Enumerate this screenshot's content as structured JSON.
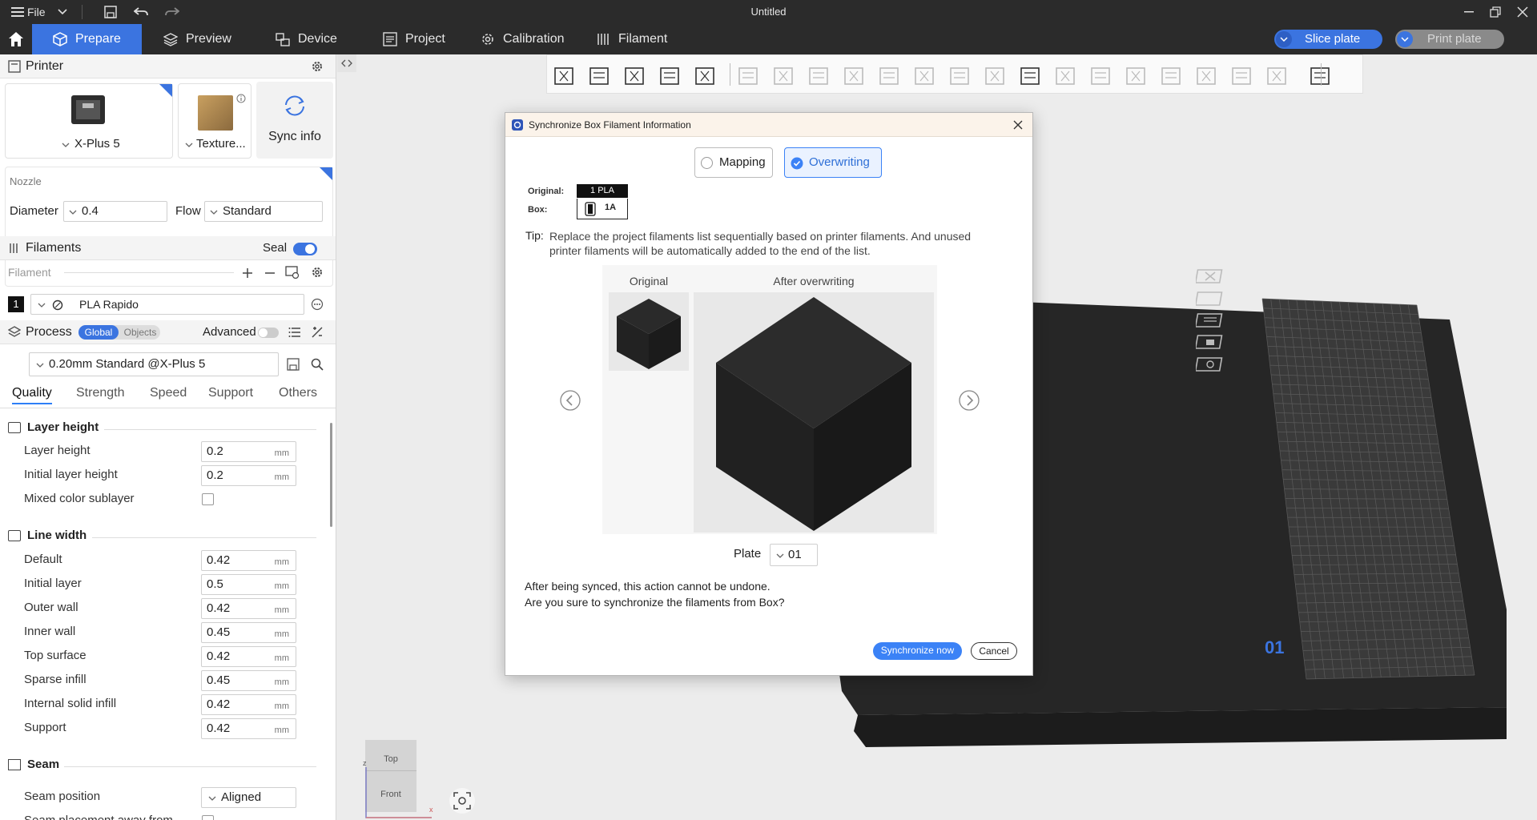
{
  "window": {
    "title": "Untitled",
    "menu_label": "File"
  },
  "tabs": [
    {
      "label": "Prepare",
      "icon": "cube-icon"
    },
    {
      "label": "Preview",
      "icon": "layers-icon"
    },
    {
      "label": "Device",
      "icon": "device-icon"
    },
    {
      "label": "Project",
      "icon": "project-icon"
    },
    {
      "label": "Calibration",
      "icon": "calibration-icon"
    },
    {
      "label": "Filament",
      "icon": "filament-icon"
    }
  ],
  "actions": {
    "slice": "Slice plate",
    "print": "Print plate"
  },
  "printer": {
    "section": "Printer",
    "name": "X-Plus 5",
    "plate": "Texture...",
    "sync": "Sync info",
    "nozzle_label": "Nozzle",
    "diameter_label": "Diameter",
    "diameter": "0.4",
    "flow_label": "Flow",
    "flow": "Standard"
  },
  "filaments": {
    "section": "Filaments",
    "seal_label": "Seal",
    "filament_label": "Filament",
    "items": [
      {
        "index": "1",
        "name": "PLA Rapido"
      }
    ]
  },
  "process": {
    "section": "Process",
    "global": "Global",
    "objects": "Objects",
    "advanced": "Advanced",
    "preset": "0.20mm Standard @X-Plus 5",
    "tabs": [
      "Quality",
      "Strength",
      "Speed",
      "Support",
      "Others"
    ],
    "groups": {
      "layer_height": {
        "title": "Layer height",
        "rows": [
          {
            "label": "Layer height",
            "value": "0.2",
            "unit": "mm"
          },
          {
            "label": "Initial layer height",
            "value": "0.2",
            "unit": "mm"
          }
        ],
        "mixed": "Mixed color sublayer"
      },
      "line_width": {
        "title": "Line width",
        "rows": [
          {
            "label": "Default",
            "value": "0.42",
            "unit": "mm"
          },
          {
            "label": "Initial layer",
            "value": "0.5",
            "unit": "mm"
          },
          {
            "label": "Outer wall",
            "value": "0.42",
            "unit": "mm"
          },
          {
            "label": "Inner wall",
            "value": "0.45",
            "unit": "mm"
          },
          {
            "label": "Top surface",
            "value": "0.42",
            "unit": "mm"
          },
          {
            "label": "Sparse infill",
            "value": "0.45",
            "unit": "mm"
          },
          {
            "label": "Internal solid infill",
            "value": "0.42",
            "unit": "mm"
          },
          {
            "label": "Support",
            "value": "0.42",
            "unit": "mm"
          }
        ]
      },
      "seam": {
        "title": "Seam",
        "position_label": "Seam position",
        "position": "Aligned",
        "away_label": "Seam placement away from"
      }
    }
  },
  "viewport": {
    "plate_number": "01",
    "view_cube": {
      "top": "Top",
      "front": "Front",
      "z": "z",
      "x": "x"
    }
  },
  "dialog": {
    "title": "Synchronize Box Filament Information",
    "mode_mapping": "Mapping",
    "mode_overwriting": "Overwriting",
    "original_label": "Original:",
    "original_value": "1 PLA",
    "box_label": "Box:",
    "box_value": "1A",
    "tip_label": "Tip:",
    "tip_text": "Replace the project filaments list sequentially based on printer filaments. And unused printer filaments will be automatically added to the end of the list.",
    "preview_original": "Original",
    "preview_after": "After overwriting",
    "plate_label": "Plate",
    "plate_value": "01",
    "warning_1": "After being synced, this action cannot be undone.",
    "warning_2": "Are you sure to synchronize the filaments from Box?",
    "confirm": "Synchronize now",
    "cancel": "Cancel"
  },
  "colors": {
    "accent": "#3b74e0",
    "filament": "#2b2b2b",
    "bed": "#2e2e2e"
  }
}
